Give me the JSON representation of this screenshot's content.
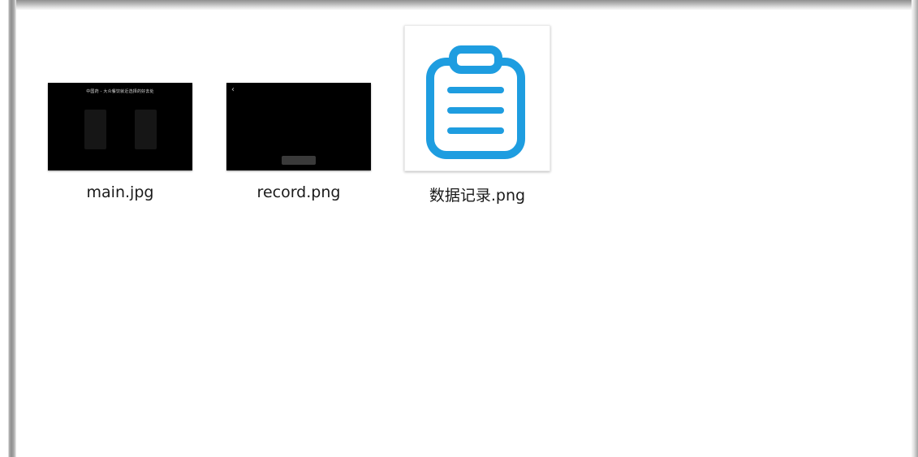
{
  "window": {
    "view": "large-icons"
  },
  "files": [
    {
      "name": "main.jpg",
      "thumbnail": {
        "kind": "dark-screenshot",
        "caption": "中国药 - 大众餐饮就近选择的好去处",
        "background": "#000000"
      }
    },
    {
      "name": "record.png",
      "thumbnail": {
        "kind": "dark-screenshot",
        "back_glyph": "‹",
        "background": "#000000"
      }
    },
    {
      "name": "数据记录.png",
      "thumbnail": {
        "kind": "clipboard-icon",
        "icon": "clipboard-list-icon",
        "color": "#1e9de0"
      }
    }
  ]
}
